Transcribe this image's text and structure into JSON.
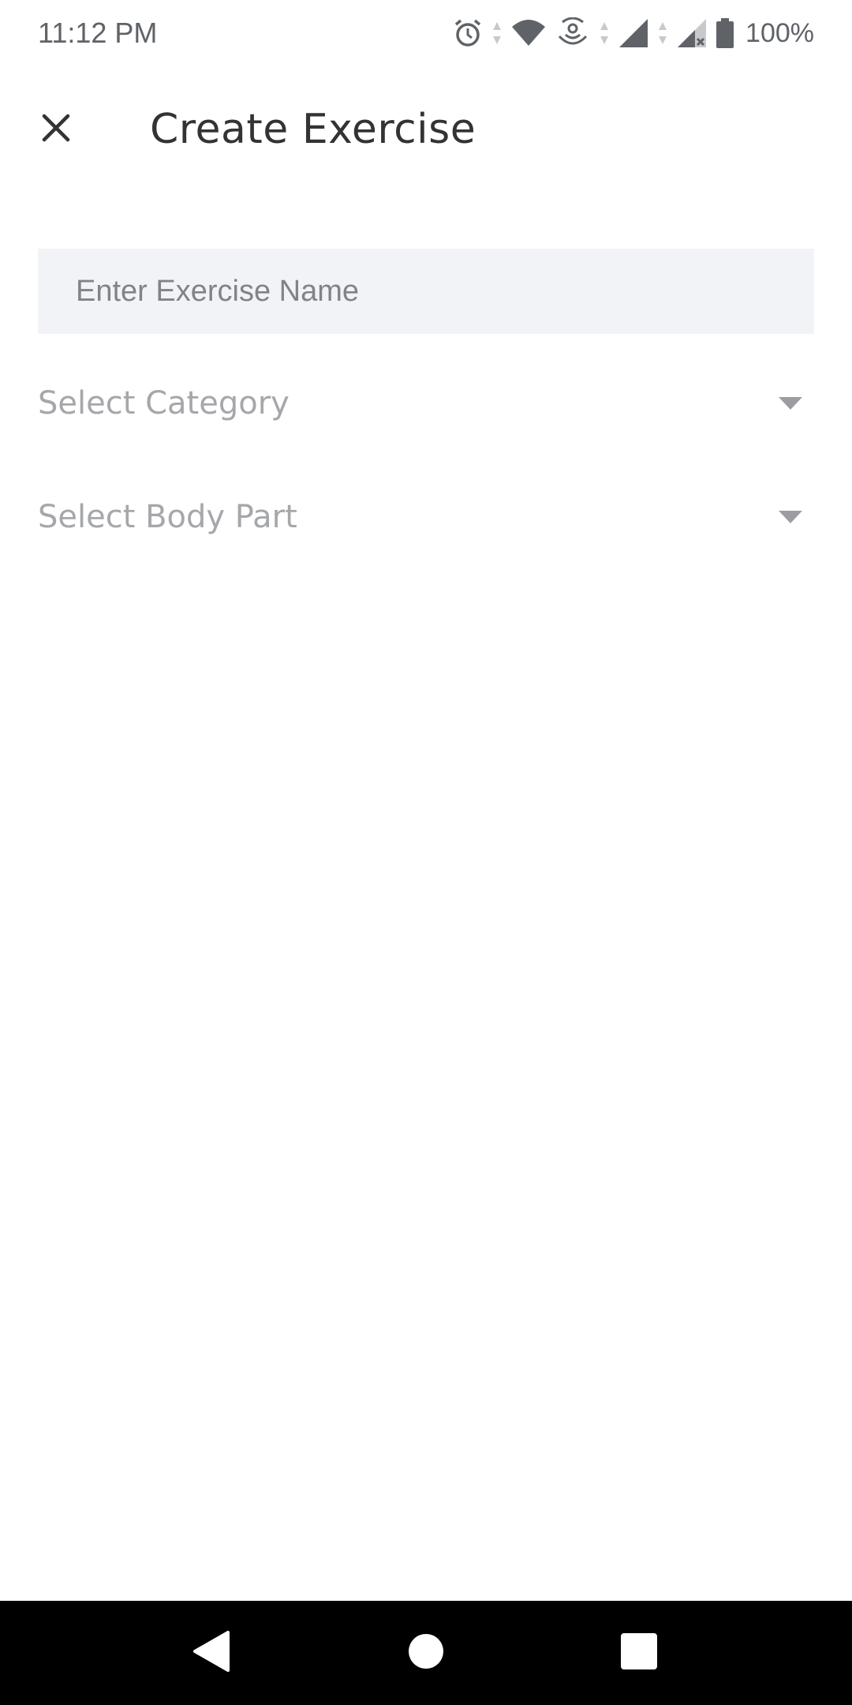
{
  "status_bar": {
    "time": "11:12 PM",
    "battery_percent": "100%",
    "icons": [
      "alarm-icon",
      "wifi-icon",
      "hotspot-icon",
      "signal-icon",
      "signal-no-service-icon",
      "battery-icon"
    ]
  },
  "app_bar": {
    "title": "Create Exercise",
    "close_icon": "close-icon"
  },
  "form": {
    "name_placeholder": "Enter Exercise Name",
    "name_value": "",
    "category_label": "Select Category",
    "body_part_label": "Select Body Part"
  },
  "nav_bar": {
    "icons": [
      "back-icon",
      "home-icon",
      "recents-icon"
    ]
  },
  "colors": {
    "field_background": "#f2f3f6",
    "dropdown_text": "#a5a7ab",
    "title_text": "#333333",
    "nav_background": "#000000"
  }
}
